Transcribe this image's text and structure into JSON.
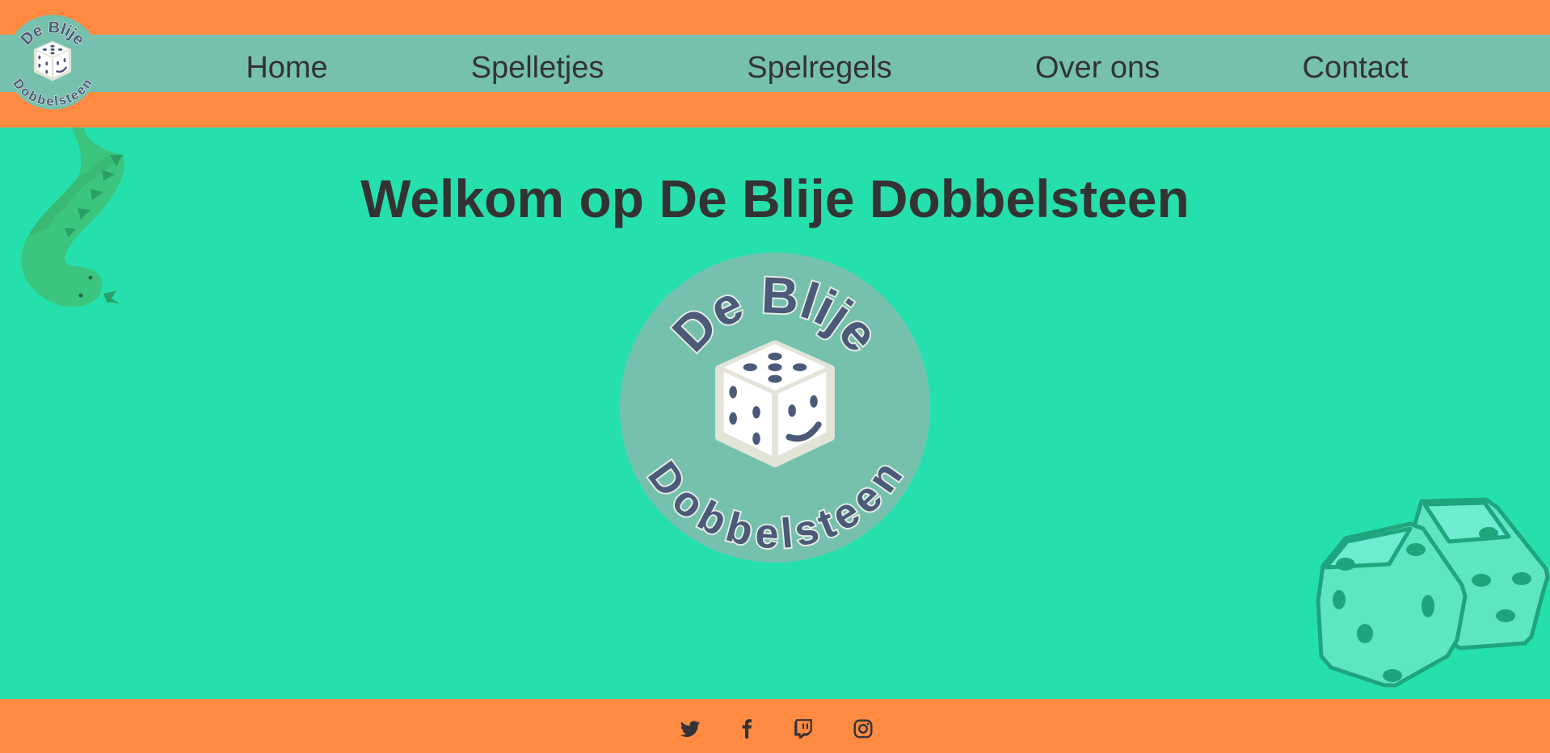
{
  "site": {
    "brand_line1": "De Blije",
    "brand_line2": "Dobbelsteen"
  },
  "nav": {
    "items": [
      {
        "label": "Home"
      },
      {
        "label": "Spelletjes"
      },
      {
        "label": "Spelregels"
      },
      {
        "label": "Over ons"
      },
      {
        "label": "Contact"
      }
    ]
  },
  "hero": {
    "title": "Welkom op De Blije Dobbelsteen"
  },
  "footer": {
    "social": [
      {
        "icon": "twitter-icon"
      },
      {
        "icon": "facebook-icon"
      },
      {
        "icon": "twitch-icon"
      },
      {
        "icon": "instagram-icon"
      }
    ]
  },
  "colors": {
    "header_orange": "#ff8a42",
    "nav_teal": "#76c1ae",
    "page_green": "#25e0ad",
    "text_dark": "#333333",
    "die_pip": "#4a5a78"
  }
}
